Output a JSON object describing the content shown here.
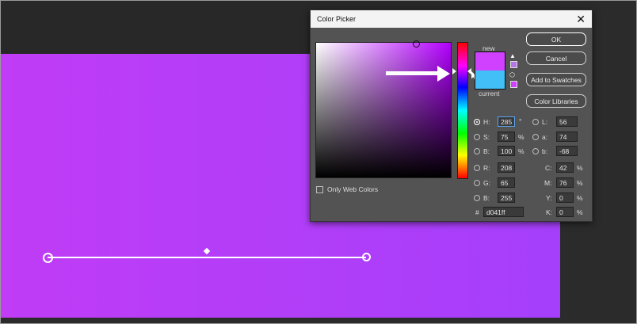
{
  "dialog": {
    "title": "Color Picker",
    "close_glyph": "✕",
    "new_label": "new",
    "current_label": "current",
    "new_color": "#d041ff",
    "current_color": "#41bff6",
    "warning_glyph": "▲",
    "cube_glyph": "⬡"
  },
  "buttons": {
    "ok": "OK",
    "cancel": "Cancel",
    "add_to_swatches": "Add to Swatches",
    "color_libraries": "Color Libraries"
  },
  "hsb": {
    "h_label": "H:",
    "h_value": "285",
    "h_unit": "°",
    "s_label": "S:",
    "s_value": "75",
    "s_unit": "%",
    "b_label": "B:",
    "b_value": "100",
    "b_unit": "%"
  },
  "rgb": {
    "r_label": "R:",
    "r_value": "208",
    "g_label": "G:",
    "g_value": "65",
    "b_label": "B:",
    "b_value": "255"
  },
  "lab": {
    "l_label": "L:",
    "l_value": "56",
    "a_label": "a:",
    "a_value": "74",
    "b_label": "b:",
    "b_value": "-68"
  },
  "cmyk": {
    "c_label": "C:",
    "c_value": "42",
    "m_label": "M:",
    "m_value": "76",
    "y_label": "Y:",
    "y_value": "0",
    "k_label": "K:",
    "k_value": "0",
    "unit": "%"
  },
  "hex": {
    "label": "#",
    "value": "d041ff"
  },
  "only_web_colors": "Only Web Colors",
  "canvas": {
    "gradient_start": "#c03cf6",
    "gradient_end": "#a53ffb"
  }
}
